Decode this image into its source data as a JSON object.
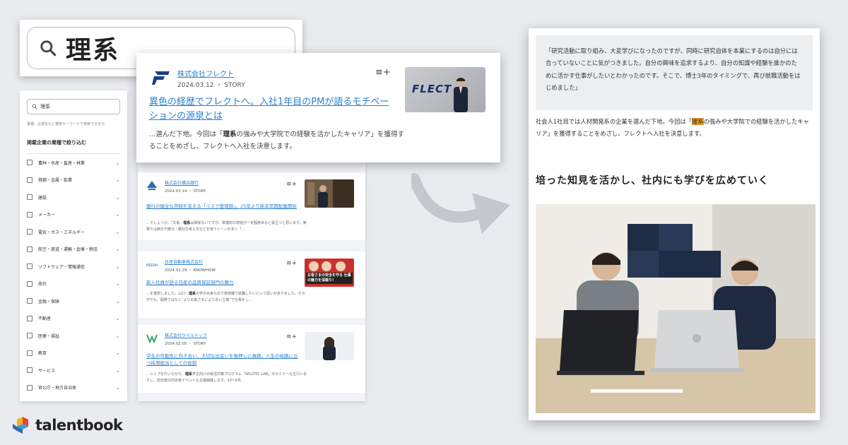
{
  "search": {
    "query": "理系"
  },
  "sidebar": {
    "search_value": "理系",
    "hint": "業種、企業名など複数キーワードで検索できます。",
    "heading": "掲載企業の業種で絞り込む",
    "items": [
      {
        "label": "農林・水産・畜産・林業"
      },
      {
        "label": "鉄鋼・金属・鉱業"
      },
      {
        "label": "建設"
      },
      {
        "label": "メーカー"
      },
      {
        "label": "電気・ガス・エネルギー"
      },
      {
        "label": "航空・鉄道・運輸・倉庫・物流"
      },
      {
        "label": "ソフトウェア・情報通信"
      },
      {
        "label": "商社"
      },
      {
        "label": "金融・保険"
      },
      {
        "label": "不動産"
      },
      {
        "label": "医療・福祉"
      },
      {
        "label": "教育"
      },
      {
        "label": "サービス"
      },
      {
        "label": "官公庁・地方自治体"
      }
    ]
  },
  "featured": {
    "company": "株式会社フレクト",
    "date": "2024.03.12 ・ STORY",
    "title": "異色の経歴でフレクトへ。入社1年目のPMが語るモチベーションの源泉とは",
    "excerpt_pre": "…選んだ下地。今回は「",
    "excerpt_hl": "理系",
    "excerpt_post": "の強みや大学院での経験を活かしたキャリア」を獲得することをめざし、フレクトへ入社を決意します。",
    "thumb_brand": "FLECT"
  },
  "cards": [
    {
      "company": "株式会社横浜銀行",
      "date": "2024.03.14 ・ STORY",
      "title": "銀行の健全な存続を支える「リスク管理部」。25卒より新卒早期配属開始",
      "excerpt_pre": "…でしょうか。「文系・",
      "excerpt_hl": "理系",
      "excerpt_post": "は関係ないですが、数理的な感覚が一定程度あると役立つと思います。実務では統計や微分・積分の考え方などを使うシーンが多く「…"
    },
    {
      "company": "日産自動車株式会社",
      "date": "2024.01.29 ・ KNOWHOW",
      "title": "新入社員が語る日産の品質保証部門の魅力",
      "excerpt_pre": "…を選択しました。山口：",
      "excerpt_hl": "理系",
      "excerpt_post": "大学の出身なので技術職で就職したいという思いがありました。その中でも、開発ではなく“よりお客さまにより近い立場”で仕事をし…",
      "thumb_text": "お客さまの安全を守る 仕事の魅力を深掘り!"
    },
    {
      "company": "株式会社ウイルテック",
      "date": "2024.02.05 ・ STORY",
      "title": "学生の可能性に向き合い、大切な出会いを後押しに貢献。人生の岐路に立つ採用担当としての役割",
      "excerpt_pre": "…シップを行いながら、",
      "excerpt_hl": "理系",
      "excerpt_post": "学生向けの就活対策プログラム「WILLTEC LAB」のセミナーも主行いますし、前年度の内定者イベントも主催開催します。10～5月…"
    }
  ],
  "article": {
    "quote": "「研究活動に取り組み、大変学びになったのですが、同時に研究自体を本業にするのは自分には合っていないことに気がつきました。自分の興味を追求するより、自分の知識や経験を誰かのために活かす仕事がしたいとわかったのです。そこで、博士3年のタイミングで、再び就職活動をはじめました」",
    "para_pre": "社会人1社目では人材開発系の企業を選んだ下地。今回は「",
    "para_hl": "理系",
    "para_post": "の強みや大学院での経験を活かしたキャリア」を獲得することをめざし、フレクトへ入社を決意します。",
    "heading": "培った知見を活かし、社内にも学びを広めていく"
  },
  "brand": {
    "name": "talentbook"
  },
  "colors": {
    "link": "#2a7fd1",
    "highlight": "#f3a12f",
    "background": "#e9ebee"
  }
}
